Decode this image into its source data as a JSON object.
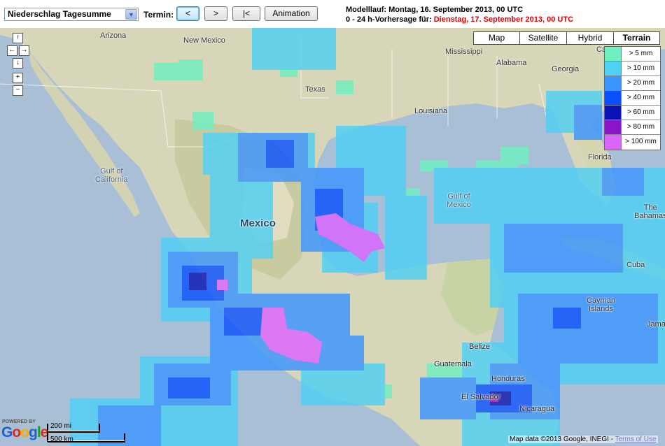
{
  "toolbar": {
    "product_select": "Niederschlag Tagesumme",
    "termin_label": "Termin:",
    "btn_prev": "<",
    "btn_next": ">",
    "btn_first": "|<",
    "btn_animation": "Animation",
    "run_text": "Modelllauf: Montag, 16. September 2013, 00 UTC",
    "forecast_prefix": "0 - 24 h-Vorhersage für:",
    "forecast_date": "Dienstag, 17. September 2013, 00 UTC"
  },
  "map": {
    "types": [
      "Map",
      "Satellite",
      "Hybrid",
      "Terrain"
    ],
    "selected_type": "Terrain",
    "labels": {
      "arizona": "Arizona",
      "new_mexico": "New Mexico",
      "mississippi": "Mississippi",
      "alabama": "Alabama",
      "georgia": "Georgia",
      "texas": "Texas",
      "louisiana": "Louisiana",
      "florida": "Florida",
      "gulf_california_1": "Gulf of",
      "gulf_california_2": "California",
      "gulf_mexico_1": "Gulf of",
      "gulf_mexico_2": "Mexico",
      "mexico": "Mexico",
      "bahamas_1": "The",
      "bahamas_2": "Bahamas",
      "cuba": "Cuba",
      "cayman_1": "Cayman",
      "cayman_2": "Islands",
      "jamaica": "Jama",
      "belize": "Belize",
      "guatemala": "Guatemala",
      "honduras": "Honduras",
      "el_salvador": "El Salvador",
      "nicaragua": "Nicaragua",
      "ca": "Ca"
    },
    "scale_mi": "200 mi",
    "scale_km": "500 km",
    "powered_by": "POWERED BY",
    "google": "Google",
    "attribution": "Map data ©2013 Google, INEGI - ",
    "terms": "Terms of Use"
  },
  "legend": [
    {
      "label": "> 5 mm",
      "color": "#6ff0c0"
    },
    {
      "label": "> 10 mm",
      "color": "#4fd0f5"
    },
    {
      "label": "> 20 mm",
      "color": "#3c96ff"
    },
    {
      "label": "> 40 mm",
      "color": "#0a50ff"
    },
    {
      "label": "> 60 mm",
      "color": "#0a14b4"
    },
    {
      "label": "> 80 mm",
      "color": "#8a14c8"
    },
    {
      "label": "> 100 mm",
      "color": "#dc64ff"
    }
  ]
}
